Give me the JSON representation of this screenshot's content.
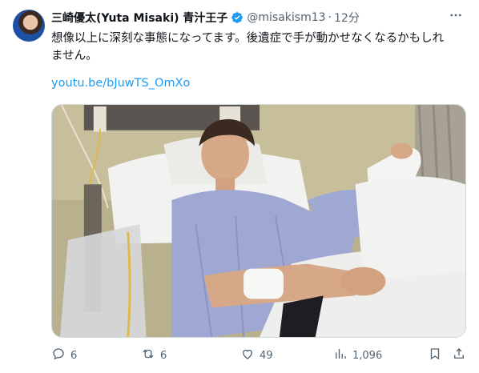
{
  "tweet": {
    "display_name": "三崎優太(Yuta Misaki) 青汁王子",
    "handle": "@misakism13",
    "separator": "·",
    "time": "12分",
    "text": "想像以上に深刻な事態になってます。後遺症で手が動かせなくなるかもしれ\nません。",
    "link": "youtu.be/bJuwTS_OmXo"
  },
  "actions": {
    "reply_count": "6",
    "retweet_count": "6",
    "like_count": "49",
    "view_count": "1,096"
  },
  "icons": {
    "verified": "verified-badge-icon",
    "more": "more-icon",
    "reply": "reply-icon",
    "retweet": "retweet-icon",
    "like": "heart-icon",
    "views": "views-icon",
    "bookmark": "bookmark-icon",
    "share": "share-icon"
  },
  "colors": {
    "link": "#1d9bf0",
    "verified": "#1d9bf0",
    "secondary_text": "#536471"
  }
}
